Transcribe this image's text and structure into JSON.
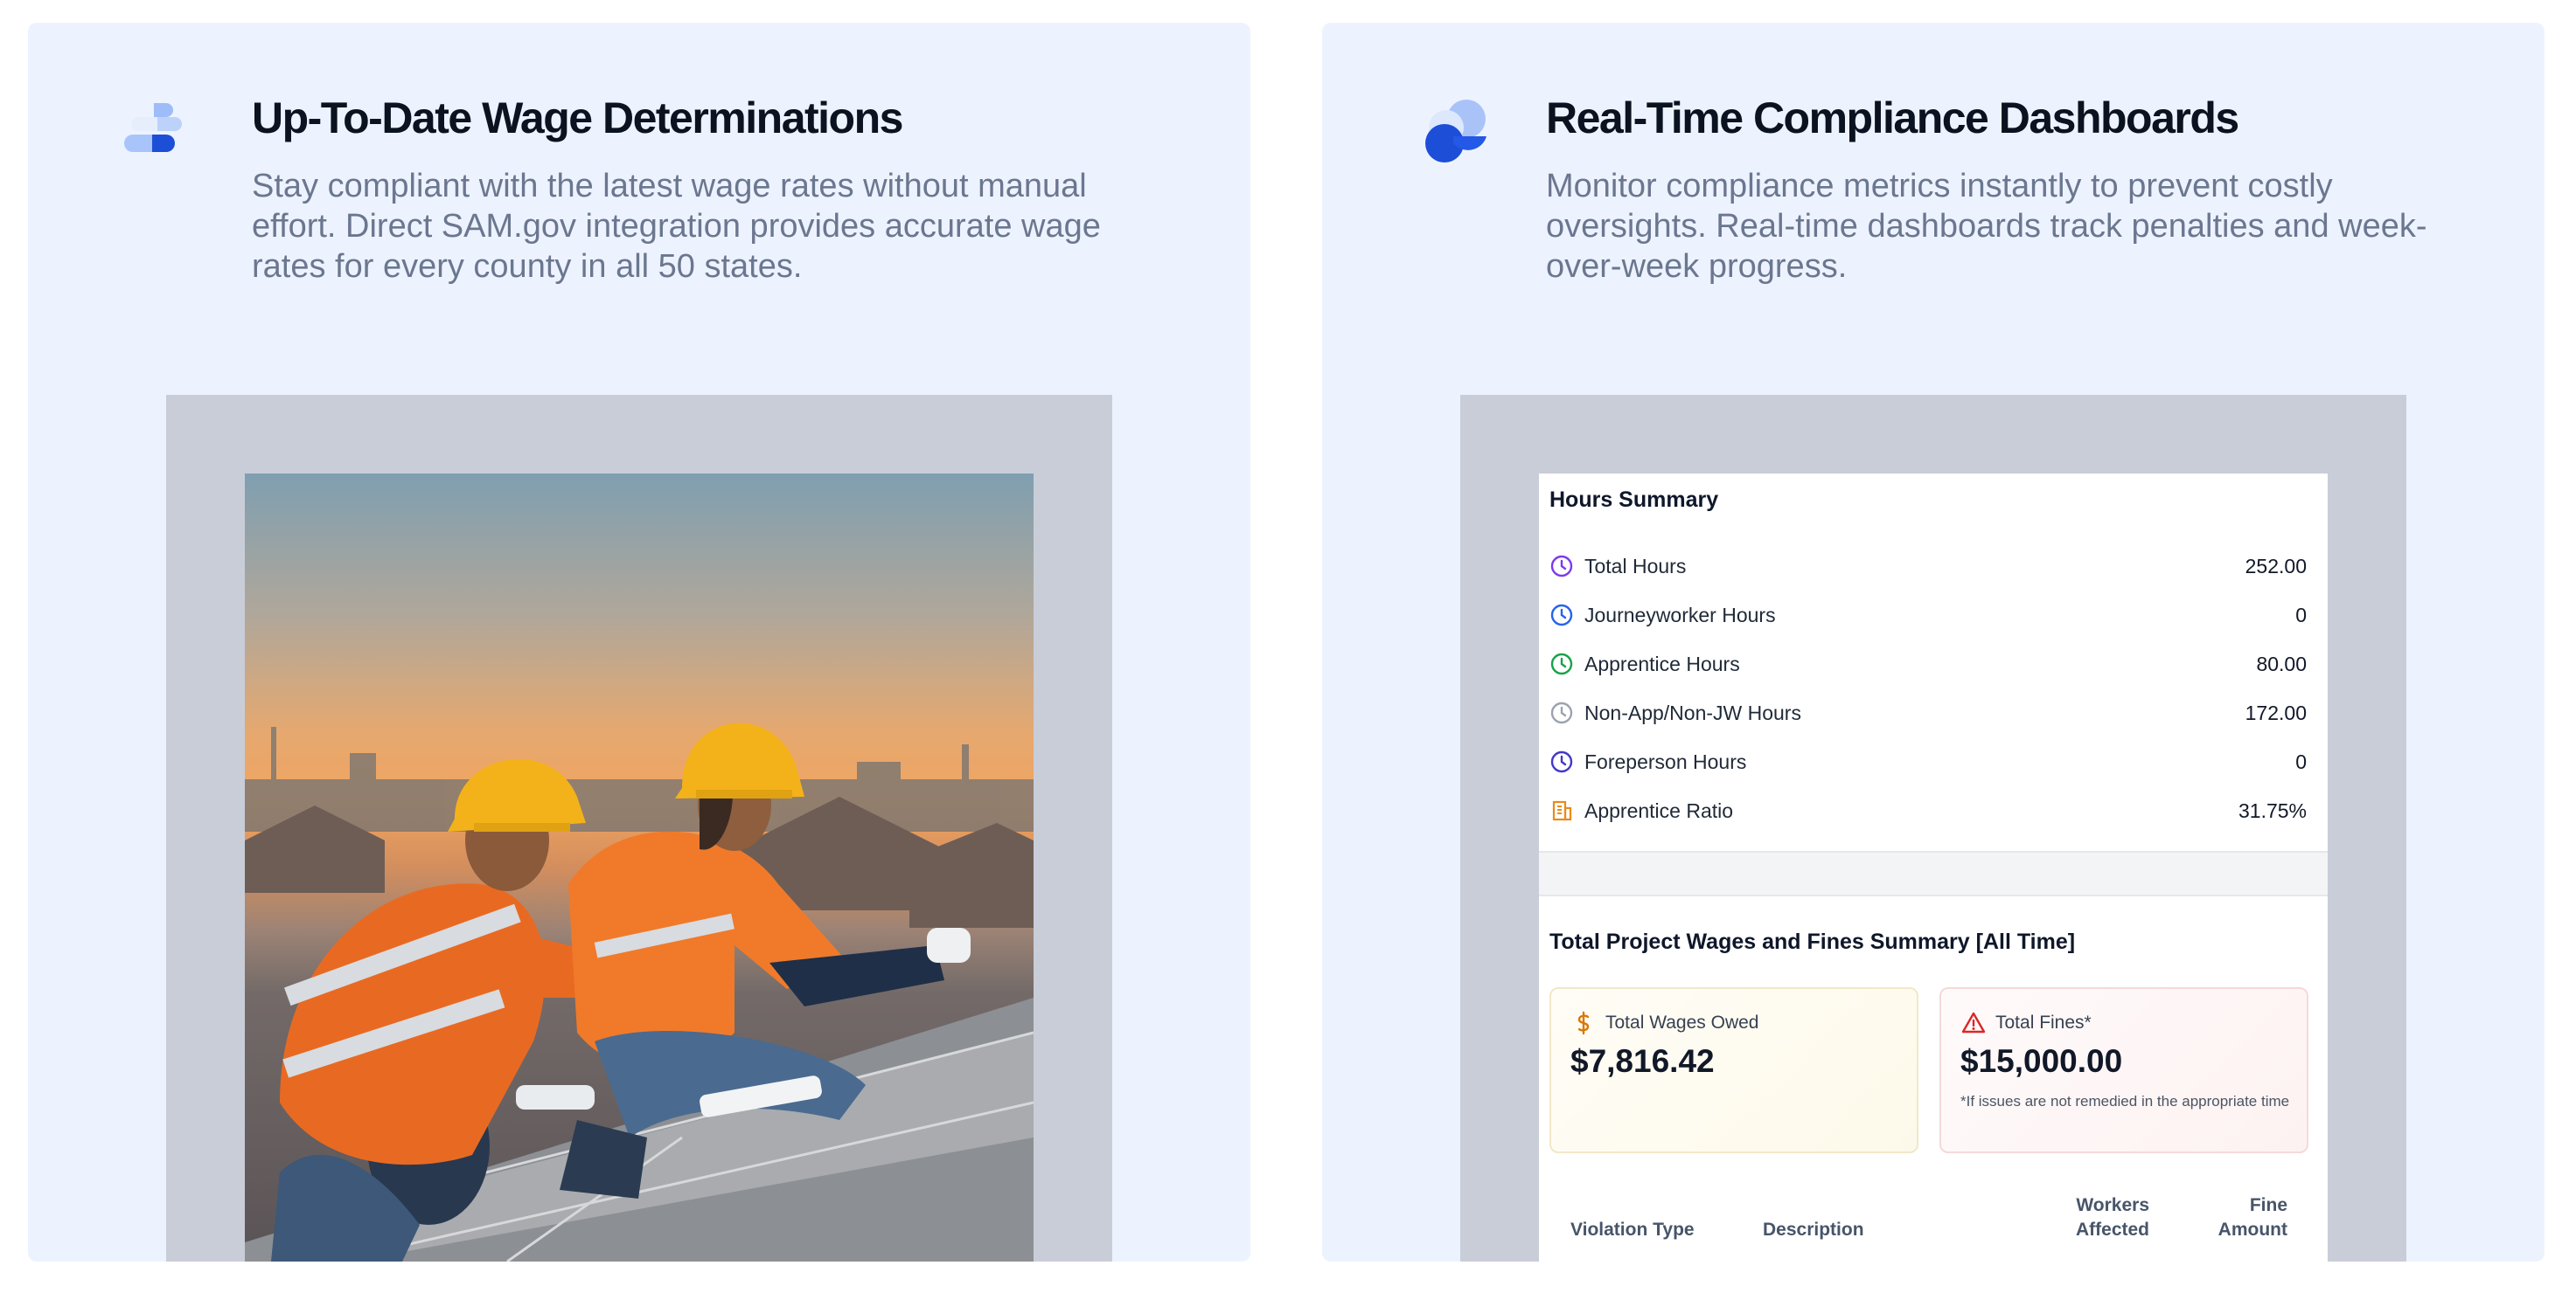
{
  "features": [
    {
      "title": "Up-To-Date Wage Determinations",
      "description": "Stay compliant with the latest wage rates without manual effort. Direct SAM.gov integration provides accurate wage rates for every county in all 50 states.",
      "icon": "stacked-blocks-logo-icon"
    },
    {
      "title": "Real-Time Compliance Dashboards",
      "description": "Monitor compliance metrics instantly to prevent costly oversights. Real-time dashboards track penalties and week-over-week progress.",
      "icon": "overlapping-circles-logo-icon"
    }
  ],
  "hours_summary": {
    "title": "Hours Summary",
    "rows": [
      {
        "label": "Total Hours",
        "value": "252.00",
        "icon": "clock-icon",
        "color": "#7c3aed"
      },
      {
        "label": "Journeyworker Hours",
        "value": "0",
        "icon": "clock-icon",
        "color": "#2563eb"
      },
      {
        "label": "Apprentice Hours",
        "value": "80.00",
        "icon": "clock-icon",
        "color": "#16a34a"
      },
      {
        "label": "Non-App/Non-JW Hours",
        "value": "172.00",
        "icon": "clock-icon",
        "color": "#9ca3af"
      },
      {
        "label": "Foreperson Hours",
        "value": "0",
        "icon": "clock-icon",
        "color": "#4338ca"
      },
      {
        "label": "Apprentice Ratio",
        "value": "31.75%",
        "icon": "building-icon",
        "color": "#ea8a1a"
      }
    ]
  },
  "wages_summary": {
    "title": "Total Project Wages and Fines Summary [All Time]",
    "wages": {
      "label": "Total Wages Owed",
      "value": "$7,816.42",
      "icon": "dollar-icon",
      "color": "#d97706"
    },
    "fines": {
      "label": "Total Fines*",
      "value": "$15,000.00",
      "note": "*If issues are not remedied in the appropriate time",
      "icon": "warning-icon",
      "color": "#dc2626"
    },
    "table_headers": [
      "Violation Type",
      "Description",
      "Workers\nAffected",
      "Fine\nAmount"
    ]
  }
}
